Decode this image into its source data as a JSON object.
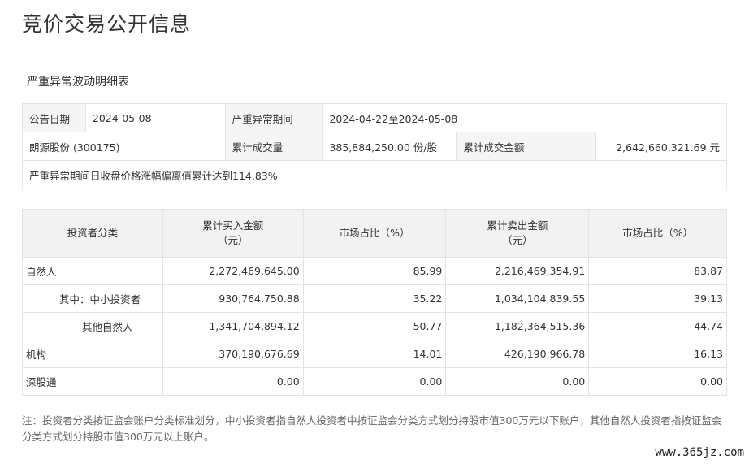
{
  "page_title": "竞价交易公开信息",
  "section_title": "严重异常波动明细表",
  "summary": {
    "announce_date_label": "公告日期",
    "announce_date": "2024-05-08",
    "period_label": "严重异常期间",
    "period": "2024-04-22至2024-05-08",
    "stock_name": "朗源股份 (300175)",
    "volume_label": "累计成交量",
    "volume": "385,884,250.00 份/股",
    "amount_label": "累计成交金额",
    "amount": "2,642,660,321.69 元",
    "deviation_text": "严重异常期间日收盘价格涨幅偏离值累计达到114.83%"
  },
  "detail": {
    "headers": {
      "category": "投资者分类",
      "buy_amount_line1": "累计买入金额",
      "buy_amount_line2": "（元）",
      "buy_share": "市场占比（%）",
      "sell_amount_line1": "累计卖出金额",
      "sell_amount_line2": "（元）",
      "sell_share": "市场占比（%）"
    },
    "rows": [
      {
        "category": "自然人",
        "buy": "2,272,469,645.00",
        "buy_pct": "85.99",
        "sell": "2,216,469,354.91",
        "sell_pct": "83.87"
      },
      {
        "category": "其中：中小投资者",
        "buy": "930,764,750.88",
        "buy_pct": "35.22",
        "sell": "1,034,104,839.55",
        "sell_pct": "39.13"
      },
      {
        "category": "其他自然人",
        "buy": "1,341,704,894.12",
        "buy_pct": "50.77",
        "sell": "1,182,364,515.36",
        "sell_pct": "44.74"
      },
      {
        "category": "机构",
        "buy": "370,190,676.69",
        "buy_pct": "14.01",
        "sell": "426,190,966.78",
        "sell_pct": "16.13"
      },
      {
        "category": "深股通",
        "buy": "0.00",
        "buy_pct": "0.00",
        "sell": "0.00",
        "sell_pct": "0.00"
      }
    ]
  },
  "note": "注：投资者分类按证监会账户分类标准划分，中小投资者指自然人投资者中按证监会分类方式划分持股市值300万元以下账户，其他自然人投资者指按证监会分类方式划分持股市值300万元以上账户。",
  "watermark": "www.365jz.com"
}
